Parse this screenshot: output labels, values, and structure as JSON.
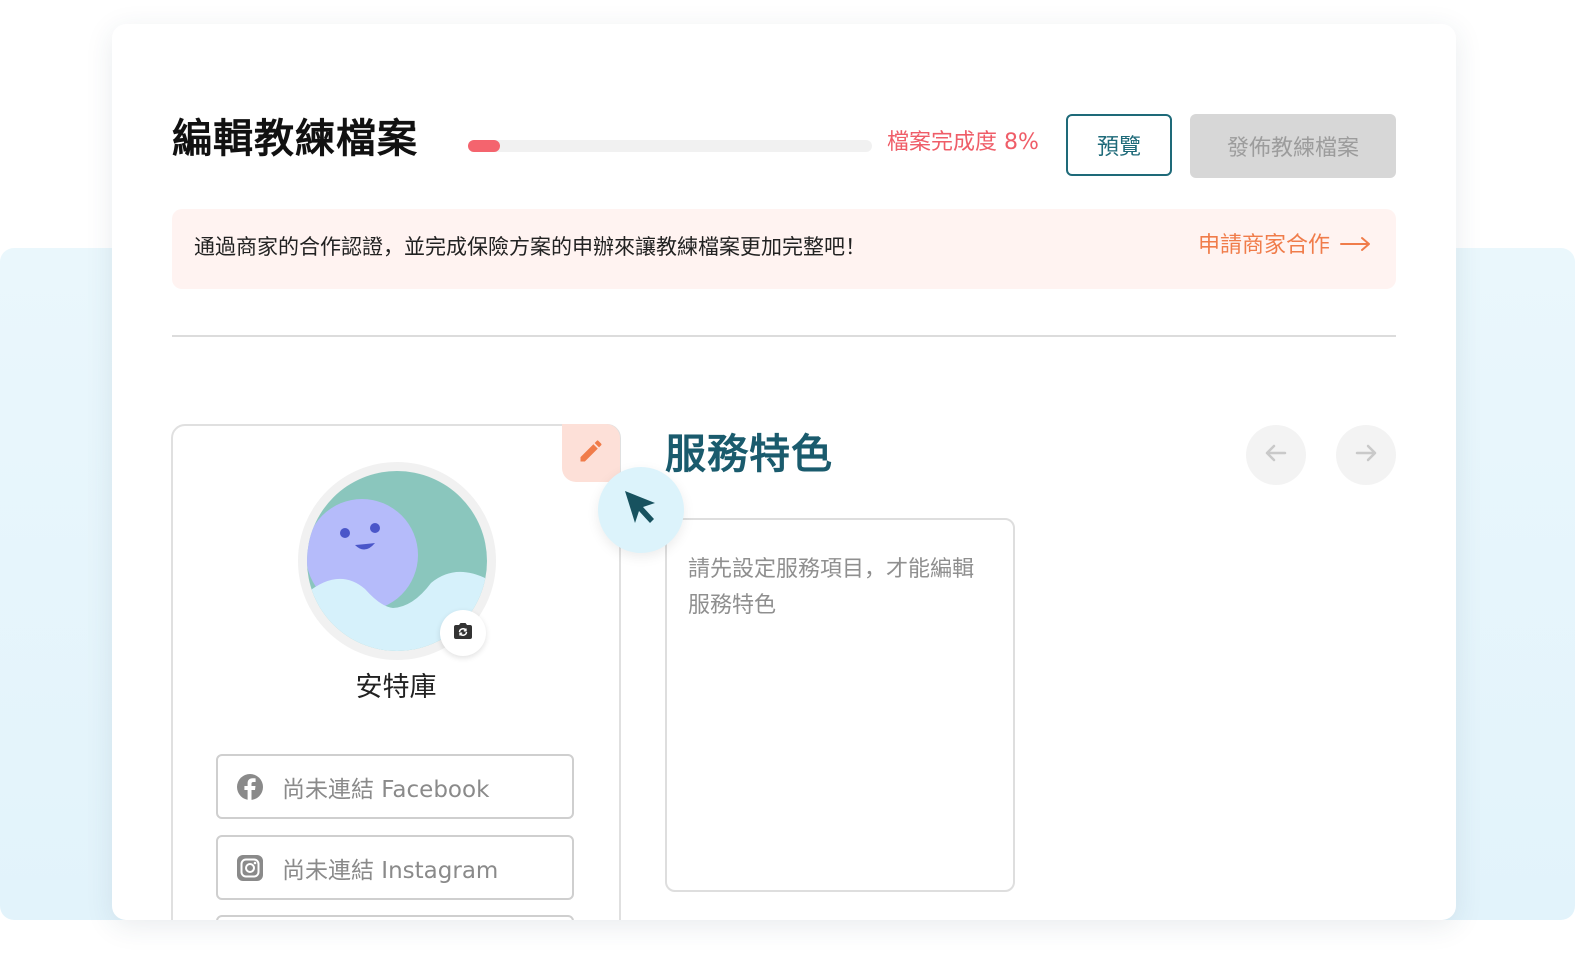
{
  "header": {
    "title": "編輯教練檔案",
    "progress_label": "檔案完成度 8%",
    "progress_percent": 8,
    "preview_label": "預覽",
    "publish_label": "發佈教練檔案"
  },
  "notice": {
    "message": "通過商家的合作認證，並完成保險方案的申辦來讓教練檔案更加完整吧！",
    "link_label": "申請商家合作"
  },
  "profile": {
    "name": "安特庫",
    "socials": [
      {
        "label": "尚未連結 Facebook",
        "icon": "facebook-icon"
      },
      {
        "label": "尚未連結 Instagram",
        "icon": "instagram-icon"
      }
    ]
  },
  "features": {
    "title": "服務特色",
    "placeholder": "請先設定服務項目，才能編輯服務特色"
  },
  "colors": {
    "primary": "#1e6a79",
    "progress": "#f4646e",
    "accent_orange": "#f07c4a",
    "notice_bg": "#fff3f1",
    "disabled": "#d7d7d7"
  },
  "icons": [
    "pencil-icon",
    "camera-icon",
    "arrow-left-icon",
    "arrow-right-icon",
    "cursor-icon",
    "arrow-right-long-icon"
  ]
}
